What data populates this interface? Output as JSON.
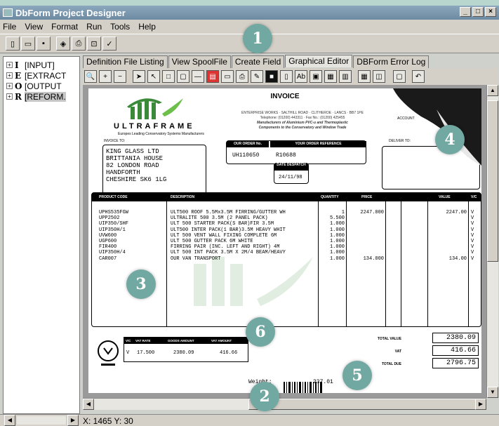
{
  "window": {
    "title": "DbForm Project Designer",
    "buttons": [
      "_",
      "□",
      "×"
    ]
  },
  "menu": [
    "File",
    "View",
    "Format",
    "Run",
    "Tools",
    "Help"
  ],
  "tree": [
    {
      "letter": "I",
      "label": "[INPUT]"
    },
    {
      "letter": "E",
      "label": "[EXTRACT"
    },
    {
      "letter": "O",
      "label": "[OUTPUT"
    },
    {
      "letter": "R",
      "label": "[REFORM."
    }
  ],
  "tabs": [
    "Definition File Listing",
    "View SpoolFile",
    "Create Field",
    "Graphical Editor",
    "DBForm Error Log"
  ],
  "active_tab": "Graphical Editor",
  "status": {
    "coords": "X: 1465 Y: 30"
  },
  "invoice": {
    "title": "INVOICE",
    "address_lines": [
      "ENTERPRISE WORKS · SALTHILL ROAD · CLITHEROE · LANCS · BB7 1PE",
      "Telephone: (01200) 443311 · Fax No.: (01200) 425455",
      "Manufacturers of Aluminium PVC-u and Thermoplastic",
      "Components to the Conservatory and Window Trade"
    ],
    "brand": "ULTRAFRAME",
    "brand_sub": "Europes Leading Conservatory Systems Manufacturers",
    "invoice_to_label": "INVOICE TO:",
    "deliver_to_label": "DELIVER TO:",
    "account_label": "ACCOUNT",
    "invoice_to": [
      "KING GLASS LTD",
      "BRITTANIA HOUSE",
      "82 LONDON ROAD",
      "HANDFORTH",
      "CHESHIRE        SK6 1LG"
    ],
    "order_no_label": "OUR ORDER No.",
    "your_ref_label": "YOUR ORDER REFERENCE",
    "order_no": "UH110650",
    "your_ref": "R10688",
    "date_label": "DATE DESPATCH",
    "date": "24/11/98",
    "col_headers": [
      "PRODUCT CODE",
      "DESCRIPTION",
      "QUANTITY",
      "PRICE",
      "VALUE",
      "V/C"
    ],
    "product_codes": [
      "UPHS535FGW",
      "UPP2502",
      "UIP350/SHF",
      "UIP350H/1",
      "UVW600",
      "UGP600",
      "FIR400",
      "UIP350H/4",
      "CAR007"
    ],
    "descriptions": [
      "ULT500 ROOF 5.5Mx3.5M FIRRING/GUTTER WH",
      "ULTRALITE 500 3.5M (2 PANEL PACK)",
      "ULT 500 STARTER PACK(S BAR)FIR 3.5M",
      "ULT500 INTER PACK(1 BAR)3.5M HEAVY WHIT",
      "ULT 500 VENT WALL FIXING COMPLETE 6M",
      "ULT 500 GUTTER PACK 6M WHITE",
      "FIRRING PAIR (INC. LEFT AND RIGHT) 4M",
      "ULT 500 INT PACK 3.5M X 2M/4 BEAM/HEAVY",
      "OUR VAN TRANSPORT"
    ],
    "quantities": [
      "1",
      "5.500",
      "1.000",
      "1.000",
      "1.000",
      "1.000",
      "1.000",
      "1.000",
      "1.000"
    ],
    "prices": [
      "2247.000",
      "",
      "",
      "",
      "",
      "",
      "",
      "",
      "134.000"
    ],
    "values": [
      "2247.00",
      "",
      "",
      "",
      "",
      "",
      "",
      "",
      "134.00"
    ],
    "vc": [
      "V",
      "V",
      "V",
      "V",
      "V",
      "V",
      "V",
      "V",
      "V"
    ],
    "vat_headers": [
      "V/C",
      "VAT RATE",
      "GOODS AMOUNT",
      "VAT AMOUNT"
    ],
    "vat_row": [
      "V",
      "17.500",
      "2380.09",
      "416.66"
    ],
    "total_value_label": "TOTAL VALUE",
    "vat_label": "VAT",
    "total_due_label": "TOTAL DUE",
    "total_value": "2380.09",
    "vat": "416.66",
    "total_due": "2796.75",
    "weight_label": "Weight:",
    "weight": "237.01"
  },
  "callouts": [
    "1",
    "2",
    "3",
    "4",
    "5",
    "6"
  ],
  "colors": {
    "titlebar": "#7b97ad",
    "badge": "#72a8a2",
    "topstrip": "#b9d6ce"
  }
}
